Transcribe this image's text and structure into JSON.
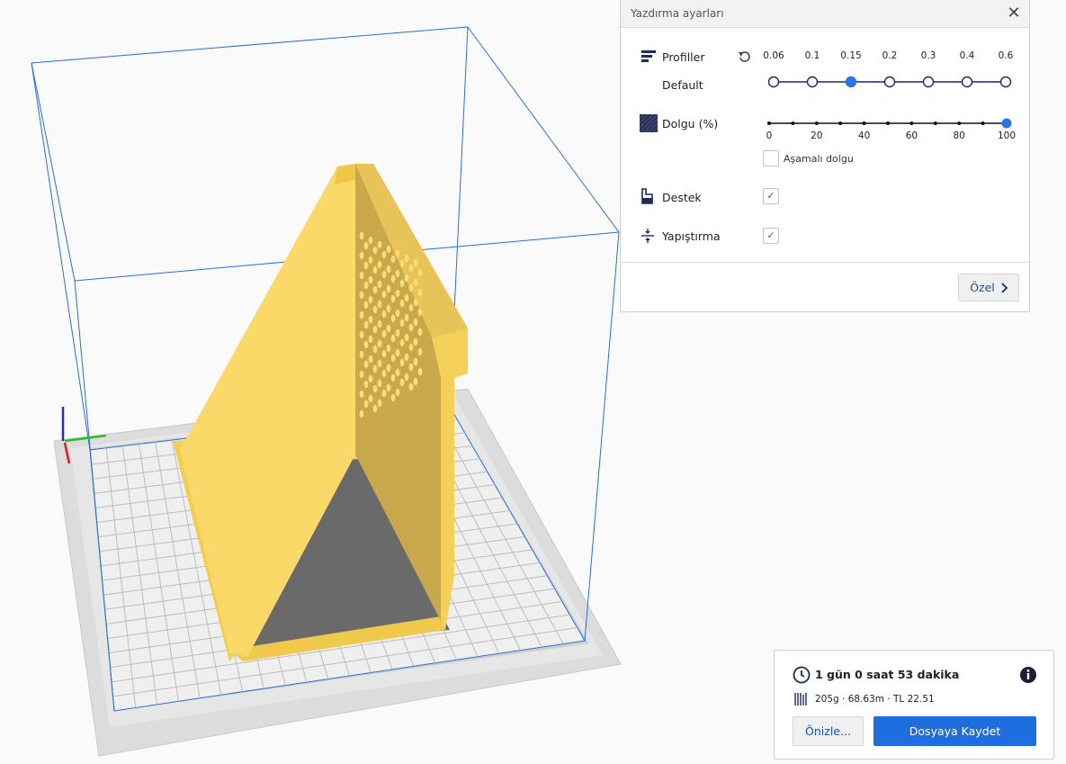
{
  "settings_panel": {
    "title": "Yazdırma ayarları",
    "profiles": {
      "label": "Profiller",
      "current": "Default",
      "layer_heights": [
        "0.06",
        "0.1",
        "0.15",
        "0.2",
        "0.3",
        "0.4",
        "0.6"
      ],
      "selected_index": 2
    },
    "infill": {
      "label": "Dolgu (%)",
      "ticks": [
        "0",
        "20",
        "40",
        "60",
        "80",
        "100"
      ],
      "value": 100
    },
    "gradual_infill": {
      "label": "Aşamalı dolgu",
      "checked": false
    },
    "support": {
      "label": "Destek",
      "checked": true
    },
    "adhesion": {
      "label": "Yapıştırma",
      "checked": true
    },
    "custom_button": "Özel"
  },
  "job": {
    "time": "1 gün 0 saat 53 dakika",
    "stats": "205g · 68.63m · TL 22.51",
    "preview_button": "Önizle...",
    "save_button": "Dosyaya Kaydet"
  },
  "colors": {
    "accent": "#2a73e8",
    "model": "#f4d35e",
    "build_volume_line": "#2a6fd6"
  }
}
